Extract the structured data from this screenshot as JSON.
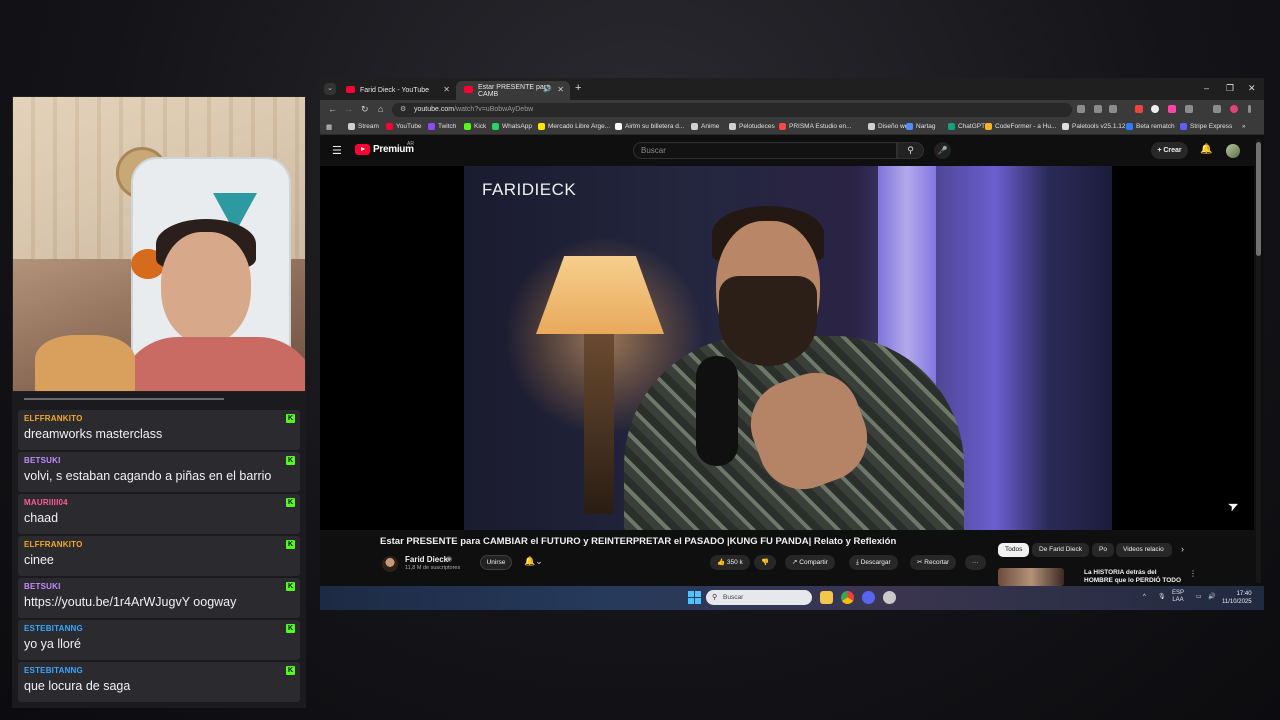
{
  "chat": {
    "messages": [
      {
        "user": "ELFFRANKITO",
        "color": "#f7a922",
        "text": "dreamworks masterclass"
      },
      {
        "user": "BETSUKI",
        "color": "#c48cff",
        "text": "volvi, s estaban cagando a piñas en el barrio"
      },
      {
        "user": "MAURIIII04",
        "color": "#ff5d8f",
        "text": "chaad"
      },
      {
        "user": "ELFFRANKITO",
        "color": "#f7a922",
        "text": "cinee"
      },
      {
        "user": "BETSUKI",
        "color": "#c48cff",
        "text": "https://youtu.be/1r4ArWJugvY oogway"
      },
      {
        "user": "ESTEBITANNG",
        "color": "#38a8ff",
        "text": "yo ya lloré"
      },
      {
        "user": "ESTEBITANNG",
        "color": "#38a8ff",
        "text": "que locura de saga"
      }
    ],
    "kick_badge": "K"
  },
  "browser": {
    "tabs": [
      {
        "label": "Farid Dieck - YouTube",
        "close": "✕"
      },
      {
        "label": "Estar PRESENTE para CAMB",
        "close": "✕"
      }
    ],
    "new_tab": "+",
    "window_controls": {
      "minimize": "–",
      "restore": "❐",
      "close": "✕"
    },
    "url_host": "youtube.com",
    "url_path": "/watch?v=uBobwAyDebw",
    "bookmarks": [
      {
        "label": "Stream",
        "color": "#cfcfcf"
      },
      {
        "label": "YouTube",
        "color": "#ff0033"
      },
      {
        "label": "Twitch",
        "color": "#9146ff"
      },
      {
        "label": "Kick",
        "color": "#53fc18"
      },
      {
        "label": "WhatsApp",
        "color": "#25d366"
      },
      {
        "label": "Mercado Libre Arge...",
        "color": "#ffe600"
      },
      {
        "label": "Airtm su billetera d...",
        "color": "#ffffff"
      },
      {
        "label": "Anime",
        "color": "#cfcfcf"
      },
      {
        "label": "Pelotudeces",
        "color": "#cfcfcf"
      },
      {
        "label": "PRISMA Estudio en...",
        "color": "#f44"
      },
      {
        "label": "Diseño web",
        "color": "#cfcfcf"
      },
      {
        "label": "Nartag",
        "color": "#4f8cff"
      },
      {
        "label": "ChatGPT",
        "color": "#10a37f"
      },
      {
        "label": "CodeFormer - a Hu...",
        "color": "#ffb020"
      },
      {
        "label": "Paletools v25.1.12",
        "color": "#dddddd"
      },
      {
        "label": "Beta rematch",
        "color": "#2b7bff"
      },
      {
        "label": "Stripe Express",
        "color": "#635bff"
      }
    ],
    "bookmarks_more": "»"
  },
  "youtube": {
    "logo_text": "Premium",
    "region": "AR",
    "search_placeholder": "Buscar",
    "create_label": "+ Crear",
    "video": {
      "brand_overlay": "FARIDIECK",
      "title": "Estar PRESENTE para CAMBIAR el FUTURO y REINTERPRETAR el PASADO |KUNG FU PANDA| Relato y Reflexión"
    },
    "channel": {
      "name": "Farid Dieck",
      "subscribers": "11,8 M de suscriptores",
      "join_label": "Unirse"
    },
    "actions": {
      "likes": "350 k",
      "share": "Compartir",
      "download": "Descargar",
      "clip": "Recortar",
      "more": "···"
    },
    "chips": [
      "Todos",
      "De Farid Dieck",
      "Po",
      "Videos relacio"
    ],
    "recommendation": {
      "title": "La HISTORIA detrás del HOMBRE que lo PERDIÓ TODO"
    }
  },
  "taskbar": {
    "search_label": "Buscar",
    "language": "ESP",
    "layout": "LAA",
    "time": "17:40",
    "date": "11/10/2025"
  }
}
